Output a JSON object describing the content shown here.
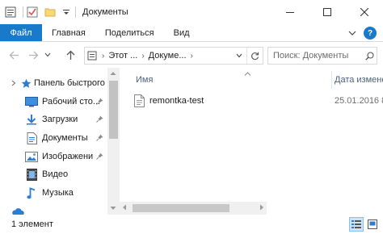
{
  "window": {
    "title": "Документы"
  },
  "ribbon": {
    "tabs": [
      {
        "label": "Файл"
      },
      {
        "label": "Главная"
      },
      {
        "label": "Поделиться"
      },
      {
        "label": "Вид"
      }
    ]
  },
  "addressbar": {
    "crumbs": [
      "Этот ...",
      "Докуме..."
    ],
    "search_placeholder": "Поиск: Документы"
  },
  "navpane": {
    "items": [
      {
        "label": "Панель быстрого",
        "icon": "star-icon",
        "pinned": false
      },
      {
        "label": "Рабочий сто...",
        "icon": "desktop-icon",
        "pinned": true
      },
      {
        "label": "Загрузки",
        "icon": "download-icon",
        "pinned": true
      },
      {
        "label": "Документы",
        "icon": "documents-icon",
        "pinned": true
      },
      {
        "label": "Изображени",
        "icon": "pictures-icon",
        "pinned": true
      },
      {
        "label": "Видео",
        "icon": "video-icon",
        "pinned": false
      },
      {
        "label": "Музыка",
        "icon": "music-icon",
        "pinned": false
      }
    ]
  },
  "filelist": {
    "columns": [
      "Имя",
      "Дата измене"
    ],
    "rows": [
      {
        "name": "remontka-test",
        "date": "25.01.2016 8"
      }
    ]
  },
  "statusbar": {
    "count_text": "1 элемент"
  },
  "colors": {
    "accent": "#1979ca",
    "folder": "#f8d775",
    "star": "#2b7cd3",
    "column_header": "#4c607a"
  }
}
